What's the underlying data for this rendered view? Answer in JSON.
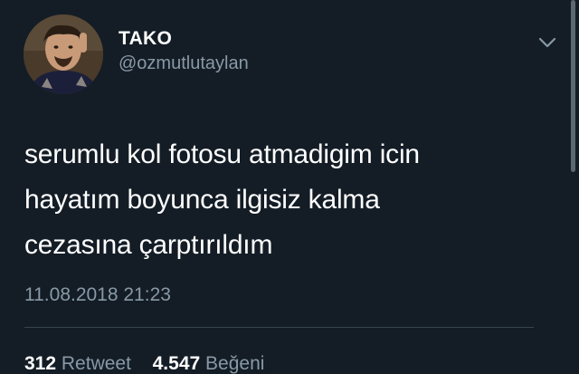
{
  "colors": {
    "background": "#141d26",
    "primary_text": "#ffffff",
    "secondary_text": "#8899a6",
    "divider": "#38444d"
  },
  "author": {
    "display_name": "TAKO",
    "handle": "@ozmutlutaylan",
    "avatar_icon": "profile-photo"
  },
  "tweet": {
    "lines": [
      "serumlu kol fotosu atmadigim icin",
      "hayatım boyunca ilgisiz kalma",
      "cezasına çarptırıldım"
    ],
    "timestamp": "11.08.2018 21:23"
  },
  "stats": {
    "retweet_count": "312",
    "retweet_label": "Retweet",
    "like_count": "4.547",
    "like_label": "Beğeni"
  },
  "menu": {
    "icon": "chevron-down-icon"
  }
}
